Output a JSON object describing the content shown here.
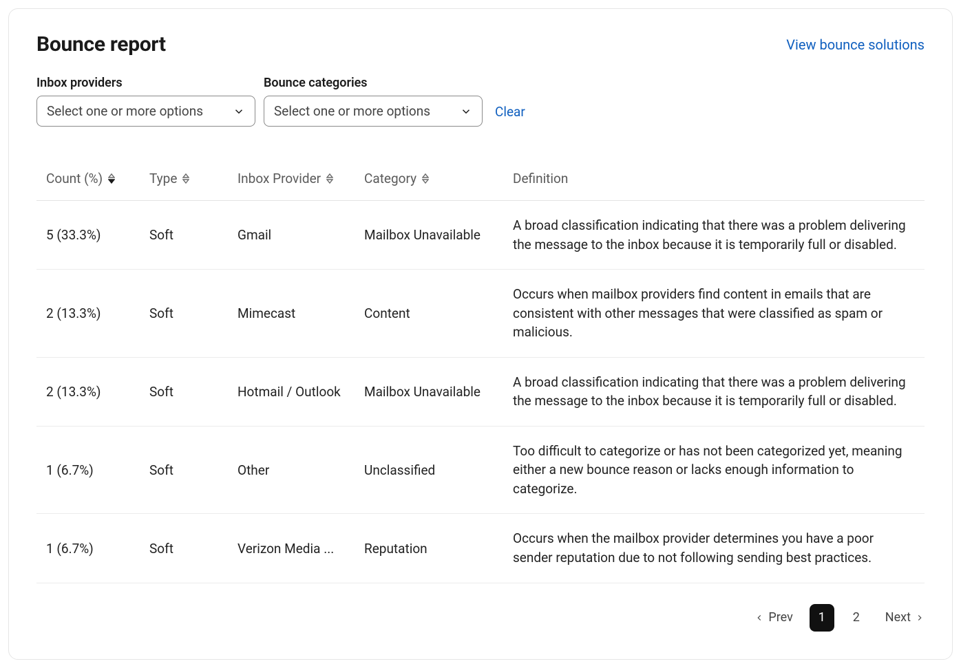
{
  "header": {
    "title": "Bounce report",
    "action_link": "View bounce solutions"
  },
  "filters": {
    "inbox_providers": {
      "label": "Inbox providers",
      "placeholder": "Select one or more options"
    },
    "bounce_categories": {
      "label": "Bounce categories",
      "placeholder": "Select one or more options"
    },
    "clear_label": "Clear"
  },
  "table": {
    "columns": {
      "count": "Count (%)",
      "type": "Type",
      "provider": "Inbox Provider",
      "category": "Category",
      "definition": "Definition"
    },
    "rows": [
      {
        "count": "5 (33.3%)",
        "type": "Soft",
        "provider": "Gmail",
        "category": "Mailbox Unavailable",
        "definition": "A broad classification indicating that there was a problem delivering the message to the inbox because it is temporarily full or disabled."
      },
      {
        "count": "2 (13.3%)",
        "type": "Soft",
        "provider": "Mimecast",
        "category": "Content",
        "definition": "Occurs when mailbox providers find content in emails that are consistent with other messages that were classified as spam or malicious."
      },
      {
        "count": "2 (13.3%)",
        "type": "Soft",
        "provider": "Hotmail / Outlook",
        "category": "Mailbox Unavailable",
        "definition": "A broad classification indicating that there was a problem delivering the message to the inbox because it is temporarily full or disabled."
      },
      {
        "count": "1 (6.7%)",
        "type": "Soft",
        "provider": "Other",
        "category": "Unclassified",
        "definition": "Too difficult to categorize or has not been categorized yet, meaning either a new bounce reason or lacks enough information to categorize."
      },
      {
        "count": "1 (6.7%)",
        "type": "Soft",
        "provider": "Verizon Media ...",
        "category": "Reputation",
        "definition": "Occurs when the mailbox provider determines you have a poor sender reputation due to not following sending best practices."
      }
    ]
  },
  "pagination": {
    "prev": "Prev",
    "next": "Next",
    "pages": [
      "1",
      "2"
    ],
    "current": "1"
  }
}
